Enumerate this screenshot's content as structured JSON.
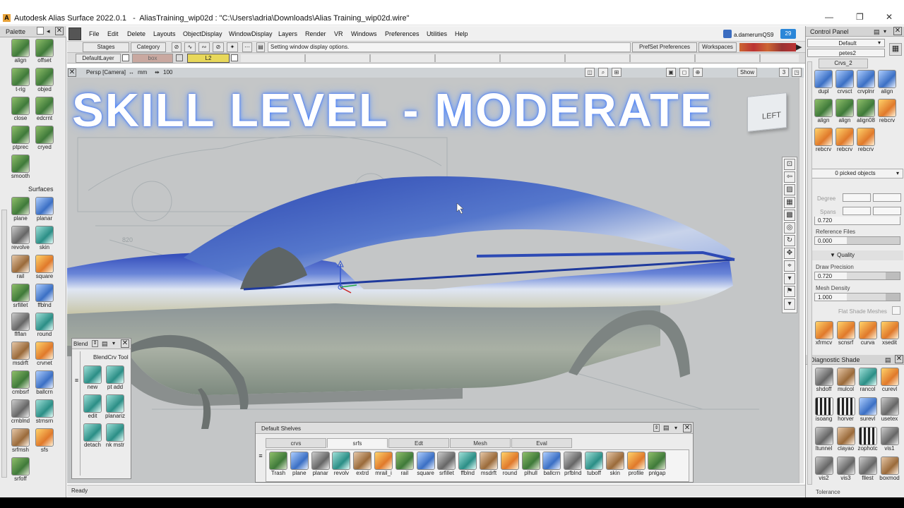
{
  "window": {
    "title": "Autodesk Alias Surface 2022.0.1   -  AliasTraining_wip02d : \"C:\\Users\\adria\\Downloads\\Alias Training_wip02d.wire\"",
    "controls": [
      "—",
      "❐",
      "✕"
    ]
  },
  "palette": {
    "title": "Palette",
    "tools_top": [
      {
        "label": "align",
        "icon": "align-icon"
      },
      {
        "label": "offset",
        "icon": "offset-icon"
      },
      {
        "label": "t-rig",
        "icon": "transform-rig-icon"
      },
      {
        "label": "objed",
        "icon": "object-edit-icon"
      },
      {
        "label": "close",
        "icon": "close-curve-icon"
      },
      {
        "label": "edcrnt",
        "icon": "edit-curve-icon"
      },
      {
        "label": "ptprec",
        "icon": "point-precision-icon"
      },
      {
        "label": "cryed",
        "icon": "curve-edit-icon"
      },
      {
        "label": "smooth",
        "icon": "smooth-icon"
      }
    ],
    "surfaces_label": "Surfaces",
    "tools_surfaces": [
      {
        "label": "plane",
        "icon": "plane-icon"
      },
      {
        "label": "planar",
        "icon": "planar-icon"
      },
      {
        "label": "revolve",
        "icon": "revolve-icon"
      },
      {
        "label": "skin",
        "icon": "skin-icon"
      },
      {
        "label": "rail",
        "icon": "rail-icon"
      },
      {
        "label": "square",
        "icon": "square-icon"
      },
      {
        "label": "srfillet",
        "icon": "surface-fillet-icon"
      },
      {
        "label": "ffblnd",
        "icon": "freeform-blend-icon"
      },
      {
        "label": "flflan",
        "icon": "flange-icon"
      },
      {
        "label": "round",
        "icon": "round-icon"
      },
      {
        "label": "msdrft",
        "icon": "draft-icon"
      },
      {
        "label": "crvnet",
        "icon": "curve-network-icon"
      },
      {
        "label": "cmbsrf",
        "icon": "combine-surface-icon"
      },
      {
        "label": "ballcrn",
        "icon": "ball-corner-icon"
      },
      {
        "label": "crnblnd",
        "icon": "corner-blend-icon"
      },
      {
        "label": "strnsrn",
        "icon": "transition-surface-icon"
      },
      {
        "label": "srfmsh",
        "icon": "surface-mesh-icon"
      },
      {
        "label": "sfs",
        "icon": "sfs-icon"
      },
      {
        "label": "srfoff",
        "icon": "surface-offset-icon"
      }
    ]
  },
  "menubar": {
    "items": [
      "File",
      "Edit",
      "Delete",
      "Layouts",
      "ObjectDisplay",
      "WindowDisplay",
      "Layers",
      "Render",
      "VR",
      "Windows",
      "Preferences",
      "Utilities",
      "Help"
    ],
    "comp_label": "comp",
    "user": "a.damerumQS9",
    "notifications": "29"
  },
  "toolbar": {
    "stages": "Stages",
    "category": "Category",
    "status_message": "Setting window display options.",
    "prefset": "PrefSet Preferences",
    "workspaces": "Workspaces",
    "default_layer": "DefaultLayer",
    "layer_box": "box",
    "layer_l2": "L2"
  },
  "viewport": {
    "camera": "Persp [Camera]",
    "units": "mm",
    "scale": "100",
    "show": "Show",
    "layout_num": "3",
    "viewcube": "LEFT",
    "dim_label": "820"
  },
  "headline": "SKILL LEVEL - MODERATE",
  "blend_window": {
    "title": "Blend",
    "tool_title": "BlendCrv Tool",
    "tools": [
      {
        "label": "new",
        "icon": "new-blend-icon"
      },
      {
        "label": "pt add",
        "icon": "point-add-icon"
      },
      {
        "label": "edit",
        "icon": "edit-blend-icon"
      },
      {
        "label": "planariz",
        "icon": "planarize-icon"
      },
      {
        "label": "detach",
        "icon": "detach-icon"
      },
      {
        "label": "nk mstr",
        "icon": "link-master-icon"
      }
    ]
  },
  "shelves": {
    "title": "Default Shelves",
    "tabs": [
      "crvs",
      "srfs",
      "Edt",
      "Mesh",
      "Eval"
    ],
    "active_tab": "srfs",
    "tools": [
      {
        "label": "Trash",
        "icon": "trash-icon"
      },
      {
        "label": "plane",
        "icon": "plane-icon"
      },
      {
        "label": "planar",
        "icon": "planar-icon"
      },
      {
        "label": "revolv",
        "icon": "revolve-icon"
      },
      {
        "label": "extrd",
        "icon": "extrude-icon"
      },
      {
        "label": "mrail_i",
        "icon": "multi-rail-icon"
      },
      {
        "label": "rail",
        "icon": "rail-icon"
      },
      {
        "label": "square",
        "icon": "square-icon"
      },
      {
        "label": "srfillet",
        "icon": "surface-fillet-icon"
      },
      {
        "label": "ffblnd",
        "icon": "freeform-blend-icon"
      },
      {
        "label": "msdrft",
        "icon": "draft-icon"
      },
      {
        "label": "round",
        "icon": "round-icon"
      },
      {
        "label": "plhull",
        "icon": "hull-icon"
      },
      {
        "label": "ballcrn",
        "icon": "ball-corner-icon"
      },
      {
        "label": "prfblnd",
        "icon": "profile-blend-icon"
      },
      {
        "label": "tuboff",
        "icon": "tube-offset-icon"
      },
      {
        "label": "skin",
        "icon": "skin-icon"
      },
      {
        "label": "profile",
        "icon": "profile-icon"
      },
      {
        "label": "pnlgap",
        "icon": "panel-gap-icon"
      }
    ]
  },
  "control_panel": {
    "title": "Control Panel",
    "preset": "Default",
    "name": "petes2",
    "shelf_tab": "Crvs_2",
    "crv_tools": [
      {
        "label": "dupl",
        "icon": "duplicate-icon"
      },
      {
        "label": "crvsct",
        "icon": "curve-section-icon"
      },
      {
        "label": "crvplnr",
        "icon": "curve-planar-icon"
      },
      {
        "label": "align",
        "icon": "align-icon"
      },
      {
        "label": "align",
        "icon": "align-icon"
      },
      {
        "label": "align",
        "icon": "align-icon"
      },
      {
        "label": "align08",
        "icon": "align-icon"
      },
      {
        "label": "rebcrv",
        "icon": "rebuild-curve-icon"
      },
      {
        "label": "rebcrv",
        "icon": "rebuild-curve-icon"
      },
      {
        "label": "rebcrv",
        "icon": "rebuild-curve-icon"
      },
      {
        "label": "rebcrv",
        "icon": "rebuild-curve-icon"
      }
    ],
    "picked": "0 picked objects",
    "degree_label": "Degree",
    "spans_label": "Spans",
    "value_720a": "0.720",
    "ref_files_label": "Reference Files",
    "ref_files_value": "0.000",
    "quality_label": "Quality",
    "draw_precision_label": "Draw Precision",
    "draw_precision_value": "0.720",
    "mesh_density_label": "Mesh Density",
    "mesh_density_value": "1.000",
    "flat_shade_label": "Flat Shade Meshes",
    "bottom_tools": [
      {
        "label": "xfrmcv",
        "icon": "transform-cv-icon"
      },
      {
        "label": "scnsrf",
        "icon": "scan-surface-icon"
      },
      {
        "label": "curva",
        "icon": "curvature-icon"
      },
      {
        "label": "xsedit",
        "icon": "cross-section-edit-icon"
      }
    ],
    "diag_title": "Diagnostic Shade",
    "diag_tools": [
      {
        "label": "shdoff",
        "icon": "shade-off-icon"
      },
      {
        "label": "mulcol",
        "icon": "multi-color-icon"
      },
      {
        "label": "rancol",
        "icon": "random-color-icon"
      },
      {
        "label": "curevl",
        "icon": "curvature-eval-icon"
      },
      {
        "label": "isoang",
        "icon": "isoangle-icon"
      },
      {
        "label": "horver",
        "icon": "horizontal-vertical-icon"
      },
      {
        "label": "surevl",
        "icon": "surface-eval-icon"
      },
      {
        "label": "usetex",
        "icon": "use-texture-icon"
      },
      {
        "label": "ltunnel",
        "icon": "light-tunnel-icon"
      },
      {
        "label": "clayao",
        "icon": "clay-ao-icon"
      },
      {
        "label": "zophotc",
        "icon": "zebra-icon"
      },
      {
        "label": "vis1",
        "icon": "visual-1-icon"
      },
      {
        "label": "vis2",
        "icon": "visual-2-icon"
      },
      {
        "label": "vis3",
        "icon": "visual-3-icon"
      },
      {
        "label": "fllest",
        "icon": "fill-test-icon"
      },
      {
        "label": "boxmod",
        "icon": "box-mode-icon"
      }
    ],
    "tolerance": "Tolerance"
  },
  "status": {
    "text": "Ready"
  },
  "colors": {
    "accent": "#3b6fc4",
    "car_body": "#4a66c8",
    "viewport_bg": "#c4c6c7"
  }
}
